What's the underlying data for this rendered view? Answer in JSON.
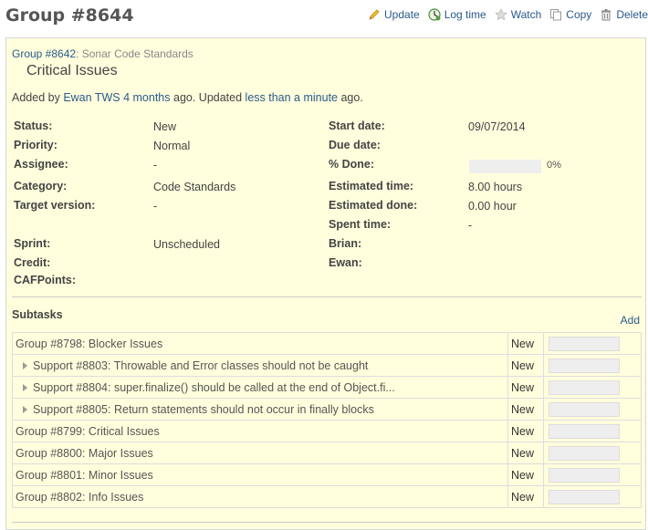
{
  "page": {
    "title": "Group #8644"
  },
  "contextual": {
    "update": "Update",
    "log_time": "Log time",
    "watch": "Watch",
    "copy": "Copy",
    "delete": "Delete"
  },
  "parent": {
    "link": "Group #8642",
    "title": ": Sonar Code Standards"
  },
  "subject": "Critical Issues",
  "author_line": {
    "added_by": "Added by",
    "author": "Ewan TWS",
    "created": "4 months",
    "ago_updated": "ago. Updated",
    "updated": "less than a minute",
    "ago": "ago."
  },
  "attributes": {
    "status": {
      "label": "Status:",
      "value": "New"
    },
    "priority": {
      "label": "Priority:",
      "value": "Normal"
    },
    "assignee": {
      "label": "Assignee:",
      "value": "-"
    },
    "category": {
      "label": "Category:",
      "value": "Code Standards"
    },
    "target_version": {
      "label": "Target version:",
      "value": "-"
    },
    "sprint": {
      "label": "Sprint:",
      "value": "Unscheduled"
    },
    "credit": {
      "label": "Credit:"
    },
    "cafpoints": {
      "label": "CAFPoints:"
    },
    "start_date": {
      "label": "Start date:",
      "value": "09/07/2014"
    },
    "due_date": {
      "label": "Due date:"
    },
    "done": {
      "label": "% Done:",
      "value": "0%",
      "fraction": 0
    },
    "estimated_time": {
      "label": "Estimated time:",
      "value": "8.00 hours"
    },
    "estimated_done": {
      "label": "Estimated done:",
      "value": "0.00 hour"
    },
    "spent_time": {
      "label": "Spent time:",
      "value": "-"
    },
    "brian": {
      "label": "Brian:"
    },
    "ewan": {
      "label": "Ewan:"
    }
  },
  "subtasks": {
    "title": "Subtasks",
    "add": "Add",
    "rows": [
      {
        "link": "Group #8798",
        "subject": ": Blocker Issues",
        "status": "New",
        "child": false
      },
      {
        "link": "Support #8803",
        "subject": ": Throwable and Error classes should not be caught",
        "status": "New",
        "child": true
      },
      {
        "link": "Support #8804",
        "subject": ": super.finalize() should be called at the end of Object.fi...",
        "status": "New",
        "child": true
      },
      {
        "link": "Support #8805",
        "subject": ": Return statements should not occur in finally blocks",
        "status": "New",
        "child": true
      },
      {
        "link": "Group #8799",
        "subject": ": Critical Issues",
        "status": "New",
        "child": false
      },
      {
        "link": "Group #8800",
        "subject": ": Major Issues",
        "status": "New",
        "child": false
      },
      {
        "link": "Group #8801",
        "subject": ": Minor Issues",
        "status": "New",
        "child": false
      },
      {
        "link": "Group #8802",
        "subject": ": Info Issues",
        "status": "New",
        "child": false
      }
    ]
  },
  "icons": {
    "update": "pencil-icon",
    "log_time": "clock-icon",
    "watch": "star-icon",
    "copy": "copy-icon",
    "delete": "trash-icon"
  },
  "colors": {
    "link": "#2a5a8a",
    "box_bg": "#ffffdd",
    "box_border": "#d7d7d7"
  }
}
